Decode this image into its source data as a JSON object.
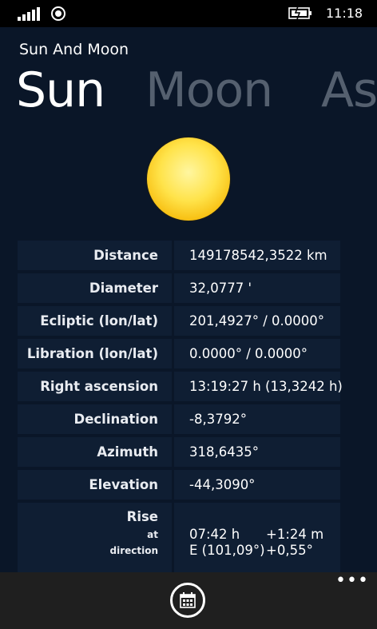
{
  "status_bar": {
    "time": "11:18"
  },
  "app": {
    "title": "Sun And Moon"
  },
  "pivot": {
    "items": [
      "Sun",
      "Moon",
      "Ast"
    ]
  },
  "colors": {
    "background": "#0a1628",
    "row_background": "#0f1e33",
    "inactive_pivot": "#55606f",
    "app_bar": "#1f1f1f"
  },
  "sun_data": {
    "rows": [
      {
        "label": "Distance",
        "value": "149178542,3522 km"
      },
      {
        "label": "Diameter",
        "value": "32,0777 '"
      },
      {
        "label": "Ecliptic (lon/lat)",
        "value": "201,4927° / 0.0000°"
      },
      {
        "label": "Libration (lon/lat)",
        "value": "0.0000° / 0.0000°"
      },
      {
        "label": "Right ascension",
        "value": "13:19:27 h (13,3242 h)"
      },
      {
        "label": "Declination",
        "value": "-8,3792°"
      },
      {
        "label": "Azimuth",
        "value": "318,6435°"
      },
      {
        "label": "Elevation",
        "value": "-44,3090°"
      }
    ],
    "rise": {
      "label": "Rise",
      "at_label": "at",
      "direction_label": "direction",
      "time": "07:42 h",
      "time_delta": "+1:24 m",
      "direction": "E (101,09°)",
      "direction_delta": "+0,55°"
    }
  },
  "app_bar": {
    "icons": [
      "calendar-icon",
      "more-icon"
    ],
    "more_label": "•••"
  }
}
